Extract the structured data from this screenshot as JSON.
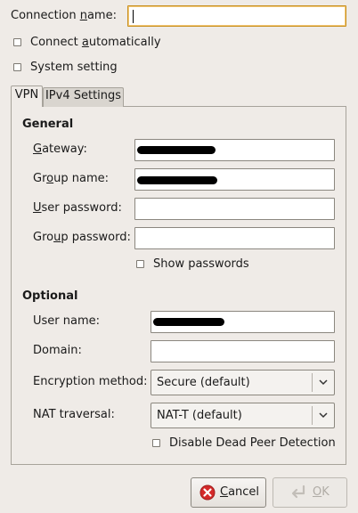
{
  "connection": {
    "name_label_pre": "Connection ",
    "name_label_u": "n",
    "name_label_post": "ame:",
    "name_value": ""
  },
  "options": {
    "connect_auto_pre": "Connect ",
    "connect_auto_u": "a",
    "connect_auto_post": "utomatically",
    "connect_auto_checked": false,
    "system_setting": "System setting",
    "system_setting_checked": false
  },
  "tabs": [
    {
      "label": "VPN",
      "active": true
    },
    {
      "label": "IPv4 Settings",
      "active": false
    }
  ],
  "general": {
    "heading": "General",
    "gateway_pre": "",
    "gateway_u": "G",
    "gateway_post": "ateway:",
    "group_name_pre": "Gr",
    "group_name_u": "o",
    "group_name_post": "up name:",
    "user_password_pre": "",
    "user_password_u": "U",
    "user_password_post": "ser password:",
    "group_password_pre": "Gro",
    "group_password_u": "u",
    "group_password_post": "p password:",
    "show_passwords": "Show passwords",
    "show_passwords_checked": false
  },
  "optional": {
    "heading": "Optional",
    "user_name": "User name:",
    "domain": "Domain:",
    "encryption_method": "Encryption method:",
    "encryption_value": "Secure (default)",
    "nat_traversal": "NAT traversal:",
    "nat_value": "NAT-T (default)",
    "disable_dpd": "Disable Dead Peer Detection",
    "disable_dpd_checked": false
  },
  "buttons": {
    "cancel_u": "C",
    "cancel_post": "ancel",
    "ok_u": "O",
    "ok_post": "K"
  },
  "colors": {
    "window_bg": "#efebe7",
    "focus_border": "#c89020",
    "cancel_icon": "#d42a2a",
    "disabled_text": "#b0aca6"
  }
}
